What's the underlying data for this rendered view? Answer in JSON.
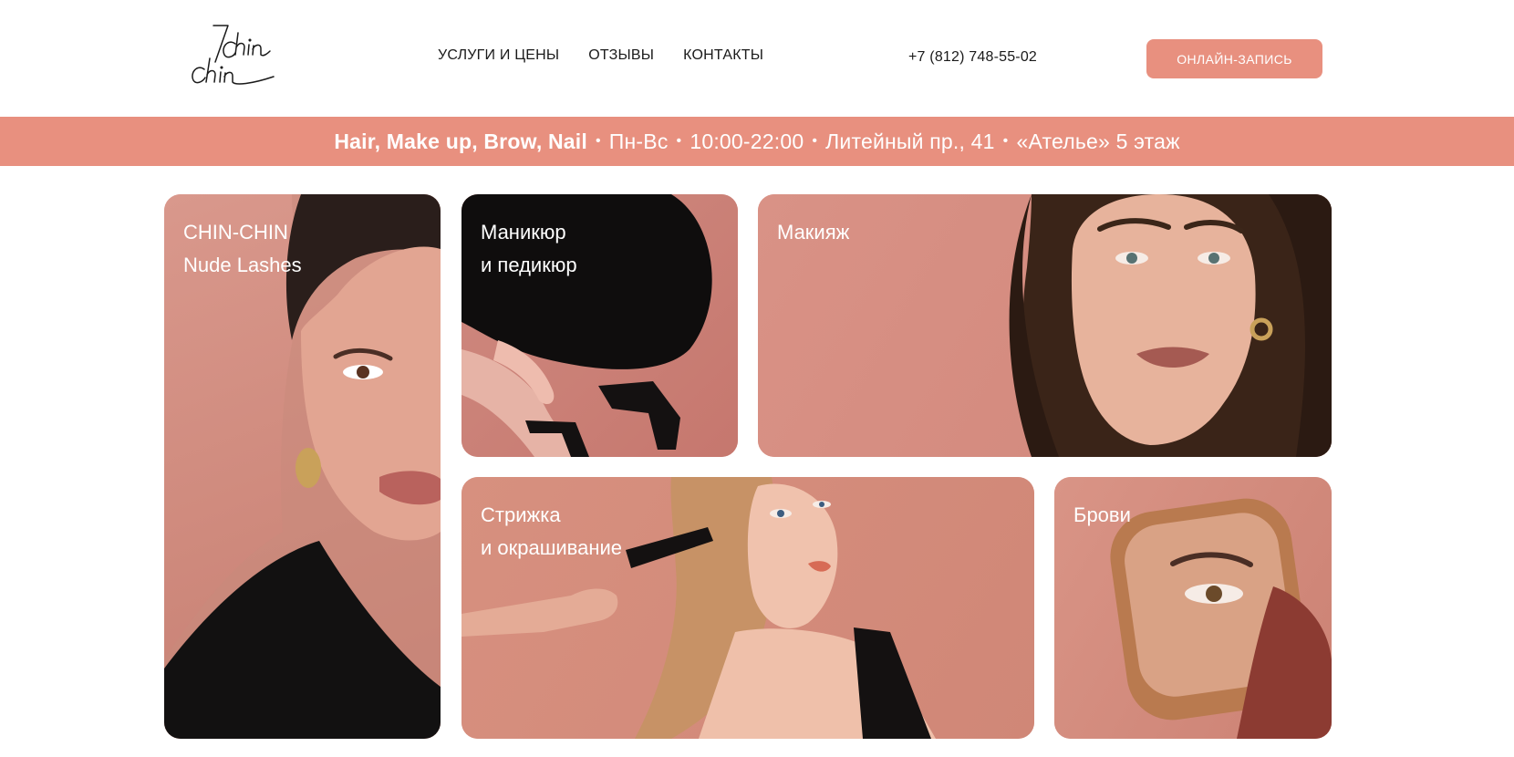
{
  "header": {
    "logo_text": "chin chin",
    "nav": [
      {
        "label": "УСЛУГИ И ЦЕНЫ"
      },
      {
        "label": "ОТЗЫВЫ"
      },
      {
        "label": "КОНТАКТЫ"
      }
    ],
    "phone": "+7 (812) 748-55-02",
    "cta_label": "ОНЛАЙН-ЗАПИСЬ"
  },
  "info_strip": {
    "services": "Hair, Make up, Brow, Nail",
    "days": "Пн-Вс",
    "hours": "10:00-22:00",
    "address": "Литейный пр., 41",
    "location": "«Ателье» 5 этаж",
    "separator": "•"
  },
  "cards": {
    "lashes": {
      "line1": "CHIN-CHIN",
      "line2": "Nude Lashes"
    },
    "nails": {
      "line1": "Маникюр",
      "line2": "и педикюр"
    },
    "makeup": {
      "line1": "Макияж"
    },
    "hair": {
      "line1": "Стрижка",
      "line2": "и окрашивание"
    },
    "brows": {
      "line1": "Брови"
    }
  },
  "colors": {
    "accent": "#e8907f",
    "card_bg": "#d9958a",
    "text": "#1a1a1a",
    "on_accent": "#ffffff"
  }
}
